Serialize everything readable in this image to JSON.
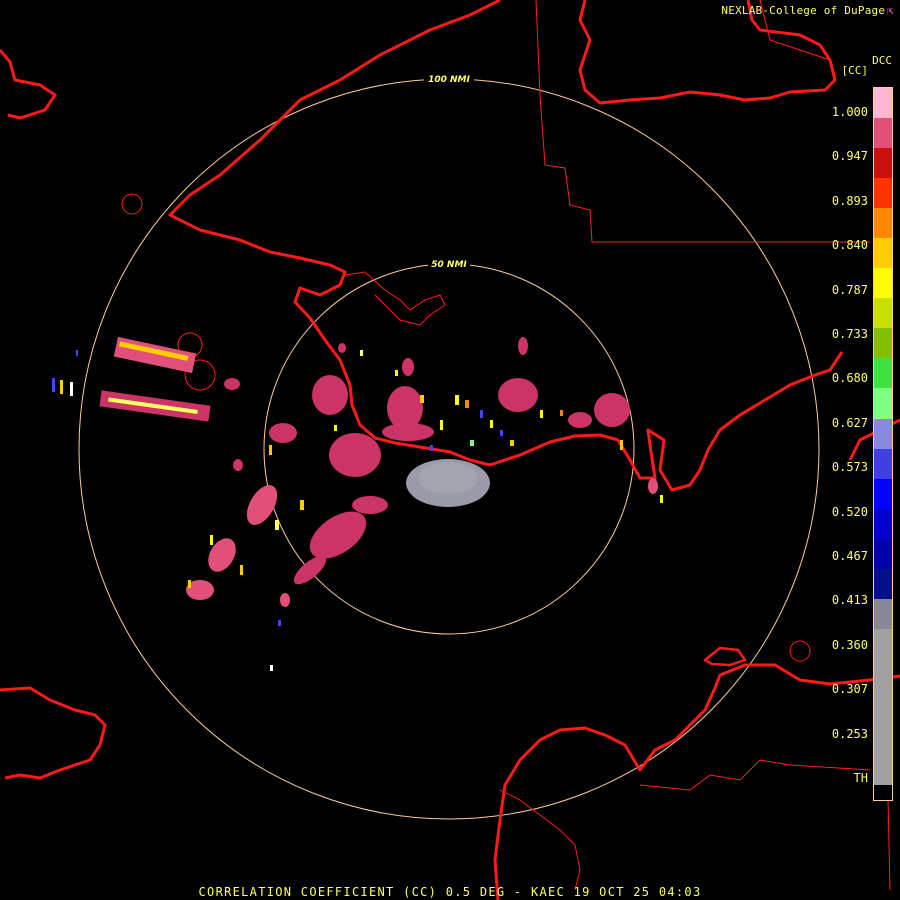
{
  "credit": {
    "text": "NEXLAB-College of DuPage",
    "icon": "arrow-icon"
  },
  "legend": {
    "title": "DCC",
    "unit": "[CC]",
    "ticks": [
      "1.000",
      "0.947",
      "0.893",
      "0.840",
      "0.787",
      "0.733",
      "0.680",
      "0.627",
      "0.573",
      "0.520",
      "0.467",
      "0.413",
      "0.360",
      "0.307",
      "0.253",
      "TH"
    ],
    "colors": [
      "#ffb6d0",
      "#e0507a",
      "#cc1010",
      "#ff3300",
      "#ff8800",
      "#ffcc00",
      "#ffff00",
      "#c8e000",
      "#80c000",
      "#40e040",
      "#80ff80",
      "#8888dd",
      "#4040e0",
      "#0000ff",
      "#0000cc",
      "#0000aa",
      "#001188",
      "#888899",
      "#a0a0a0",
      "#000000"
    ]
  },
  "range_rings": [
    {
      "label": "100 NMI"
    },
    {
      "label": "50 NMI"
    }
  ],
  "footer": "CORRELATION COEFFICIENT (CC) 0.5 DEG - KAEC 19 OCT 25 04:03",
  "colors": {
    "coastline": "#ff1a1a",
    "ring": "#ffcc99",
    "label": "#ffff66",
    "echo_high": "#cc3366",
    "ground_clutter": "#9a9aa8"
  }
}
